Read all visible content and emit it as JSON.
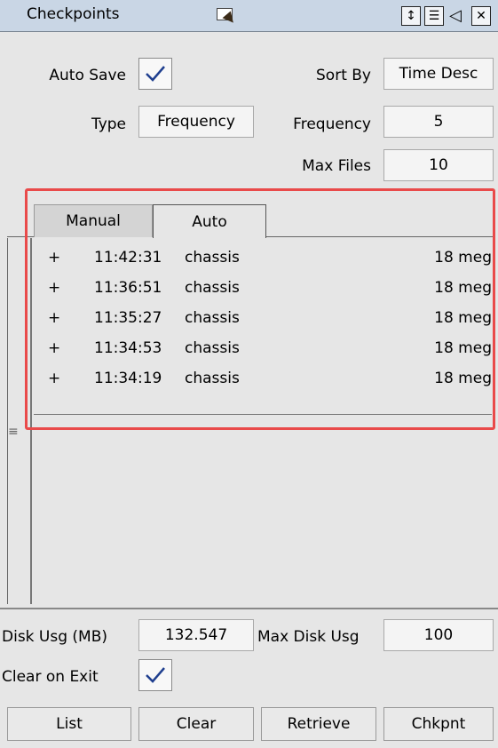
{
  "panel": {
    "title": "Checkpoints",
    "title_icons": [
      "float-icon",
      "up-down-arrows-icon",
      "list-icon",
      "collapse-left-icon",
      "close-box-icon"
    ]
  },
  "settings": {
    "auto_save_label": "Auto Save",
    "auto_save_checked": true,
    "sort_by_label": "Sort By",
    "sort_by_value": "Time Desc",
    "type_label": "Type",
    "type_value": "Frequency",
    "frequency_label": "Frequency",
    "frequency_value": "5",
    "max_files_label": "Max Files",
    "max_files_value": "10"
  },
  "tabs": [
    {
      "label": "Manual",
      "active": false
    },
    {
      "label": "Auto",
      "active": true
    }
  ],
  "checkpoints": [
    {
      "expand": "+",
      "time": "11:42:31",
      "name": "chassis",
      "size": "18 meg"
    },
    {
      "expand": "+",
      "time": "11:36:51",
      "name": "chassis",
      "size": "18 meg"
    },
    {
      "expand": "+",
      "time": "11:35:27",
      "name": "chassis",
      "size": "18 meg"
    },
    {
      "expand": "+",
      "time": "11:34:53",
      "name": "chassis",
      "size": "18 meg"
    },
    {
      "expand": "+",
      "time": "11:34:19",
      "name": "chassis",
      "size": "18 meg"
    }
  ],
  "disk": {
    "usage_label": "Disk Usg (MB)",
    "usage_value": "132.547",
    "max_label": "Max Disk Usg",
    "max_value": "100"
  },
  "clear_on_exit": {
    "label": "Clear on Exit",
    "checked": true
  },
  "buttons": {
    "list": "List",
    "clear": "Clear",
    "retrieve": "Retrieve",
    "chkpnt": "Chkpnt"
  },
  "colors": {
    "titlebar": "#c9d6e5",
    "panel_bg": "#e6e6e6",
    "highlight": "#e94a4a"
  }
}
